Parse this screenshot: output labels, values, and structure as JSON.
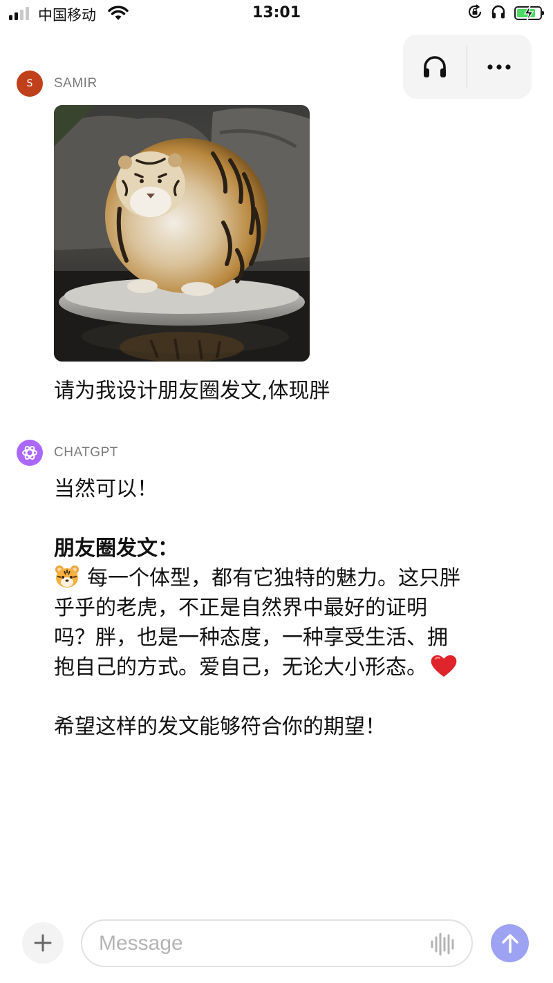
{
  "status_bar": {
    "carrier": "中国移动",
    "time": "13:01",
    "battery_state": "charging",
    "battery_level": 0.7,
    "signal_bars_filled": 2,
    "icons": [
      "signal-icon",
      "wifi-icon",
      "orientation-lock-icon",
      "headphones-icon",
      "battery-icon"
    ]
  },
  "header": {
    "controls": [
      {
        "icon": "headphones-icon"
      },
      {
        "icon": "more-icon"
      }
    ]
  },
  "conversation": {
    "user_message": {
      "avatar_initial": "S",
      "avatar_color": "#c0401c",
      "sender": "SAMIR",
      "attachment": {
        "kind": "image",
        "subject": "fat tiger on rock"
      },
      "text": "请为我设计朋友圈发文,体现胖"
    },
    "assistant_message": {
      "avatar_color": "#ab68ff",
      "sender": "CHATGPT",
      "intro": "当然可以！",
      "heading": "朋友圈发文：",
      "post_lines": [
        "每一个体型，都有它独特的魅力。这只胖",
        "乎乎的老虎，不正是自然界中最好的证明",
        "吗？胖，也是一种态度，一种享受生活、拥",
        "抱自己的方式。爱自己，无论大小形态。"
      ],
      "emojis": [
        "tiger-face-emoji",
        "red-heart-emoji"
      ],
      "closing": "希望这样的发文能够符合你的期望！"
    }
  },
  "composer": {
    "placeholder": "Message",
    "value": "",
    "accent_color": "#9da3f2"
  }
}
